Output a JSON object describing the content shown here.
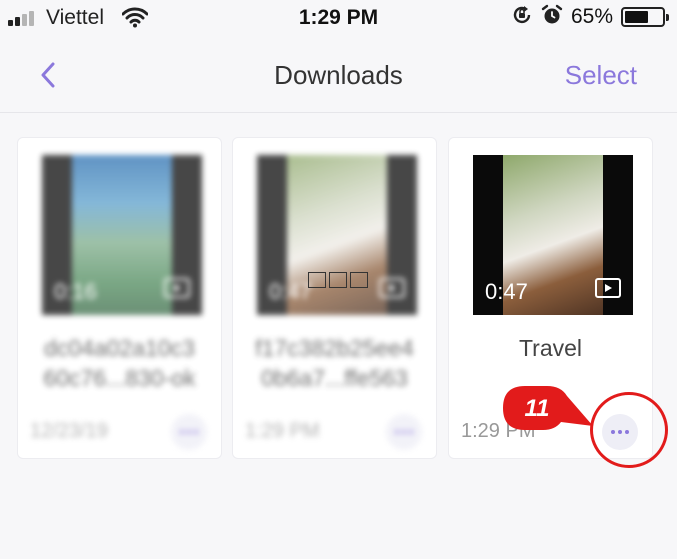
{
  "status_bar": {
    "carrier": "Viettel",
    "time": "1:29 PM",
    "battery_percent": "65%",
    "battery_level": 0.65,
    "icons": [
      "signal-icon",
      "wifi-icon",
      "orientation-lock-icon",
      "alarm-icon",
      "battery-icon"
    ]
  },
  "nav": {
    "back_icon": "chevron-left-icon",
    "title": "Downloads",
    "select_label": "Select"
  },
  "items": [
    {
      "duration": "0:16",
      "title": "dc04a02a10c3\n60c76...830-ok",
      "date": "12/23/19",
      "blurred": true
    },
    {
      "duration": "0:47",
      "title": "f17c382b25ee4\n0b6a7...ffe563",
      "date": "1:29 PM",
      "blurred": true
    },
    {
      "duration": "0:47",
      "title": "Travel",
      "date": "1:29 PM",
      "blurred": false
    }
  ],
  "annotation": {
    "step_number": "11",
    "color": "#e21b1b"
  },
  "colors": {
    "accent": "#8b78dc",
    "highlight": "#e21b1b"
  }
}
